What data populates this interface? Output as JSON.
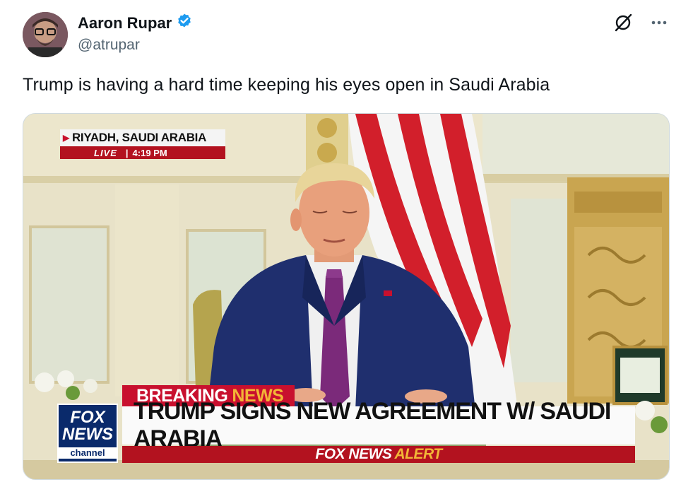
{
  "author": {
    "name": "Aaron Rupar",
    "handle": "@atrupar"
  },
  "tweet": {
    "text": "Trump is having a hard time keeping his eyes open in Saudi Arabia"
  },
  "icons": {
    "verified": "verified-badge-icon",
    "grok": "grok-icon",
    "more": "more-options-icon"
  },
  "colors": {
    "verified": "#1d9bf0",
    "fox_red": "#c8102e",
    "fox_blue": "#0a2a6b",
    "fox_yellow": "#f2b637"
  },
  "media": {
    "location": "RIYADH, SAUDI ARABIA",
    "live_label": "LIVE",
    "time": "4:19 PM",
    "separator": "|",
    "breaking_label": "BREAKING",
    "breaking_news": "NEWS",
    "headline": "TRUMP SIGNS NEW AGREEMENT W/ SAUDI ARABIA",
    "alert_prefix": "FOX NEWS",
    "alert_suffix": "ALERT",
    "logo_line1": "FOX",
    "logo_line2": "NEWS",
    "logo_line3": "channel"
  }
}
